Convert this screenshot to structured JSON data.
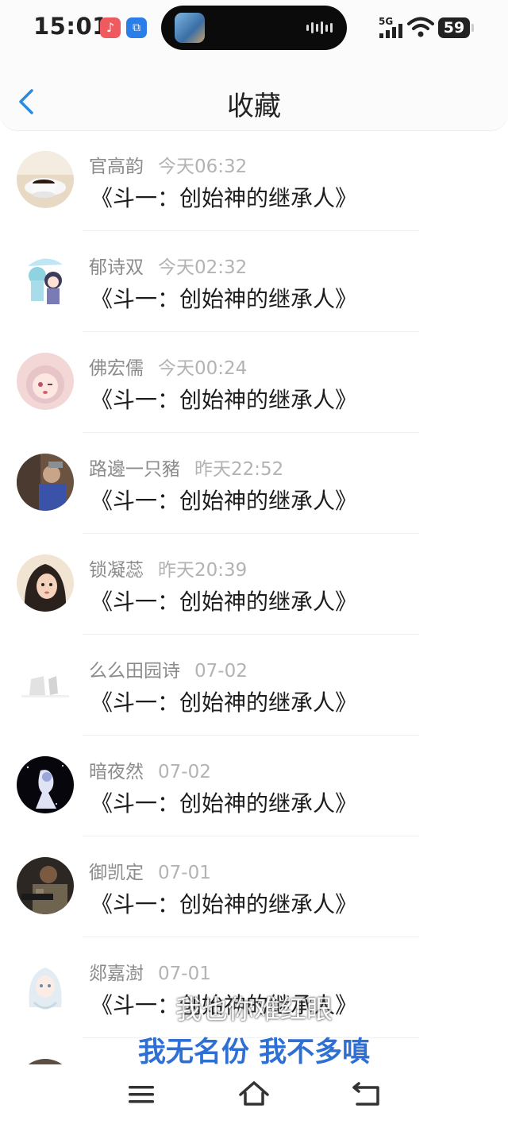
{
  "status_bar": {
    "time": "15:01",
    "app_icon_1": "music-app-icon",
    "app_icon_2": "screen-cast-icon",
    "network": "5G",
    "battery": "59"
  },
  "header": {
    "title": "收藏",
    "back_icon": "chevron-left-icon",
    "accent_color": "#2a8ae0"
  },
  "items": [
    {
      "user": "官高韵",
      "time": "今天06:32",
      "book": "《斗一：创始神的继承人》",
      "avatar": "coffee-cup-avatar"
    },
    {
      "user": "郁诗双",
      "time": "今天02:32",
      "book": "《斗一：创始神的继承人》",
      "avatar": "anime-girls-umbrella-avatar"
    },
    {
      "user": "佛宏儒",
      "time": "今天00:24",
      "book": "《斗一：创始神的继承人》",
      "avatar": "anime-girl-wink-avatar"
    },
    {
      "user": "路邊一只豬",
      "time": "昨天22:52",
      "book": "《斗一：创始神的继承人》",
      "avatar": "photo-person-avatar"
    },
    {
      "user": "锁凝蕊",
      "time": "昨天20:39",
      "book": "《斗一：创始神的继承人》",
      "avatar": "girl-portrait-avatar"
    },
    {
      "user": "么么田园诗",
      "time": "07-02",
      "book": "《斗一：创始神的继承人》",
      "avatar": "blank-white-avatar"
    },
    {
      "user": "暗夜然",
      "time": "07-02",
      "book": "《斗一：创始神的继承人》",
      "avatar": "dark-night-figure-avatar"
    },
    {
      "user": "御凯定",
      "time": "07-01",
      "book": "《斗一：创始神的继承人》",
      "avatar": "soldier-avatar"
    },
    {
      "user": "郯嘉澍",
      "time": "07-01",
      "book": "《斗一：创始神的继承人》",
      "avatar": "white-hair-anime-avatar"
    },
    {
      "user": "",
      "time": "",
      "book": "",
      "avatar": "partial-avatar"
    }
  ],
  "subtitles": {
    "line1": "我也你难红眼",
    "line2": "我无名份 我不多嗔"
  },
  "bottom_nav": {
    "menu_icon": "menu-icon",
    "home_icon": "home-icon",
    "back_icon": "back-arrow-icon"
  }
}
